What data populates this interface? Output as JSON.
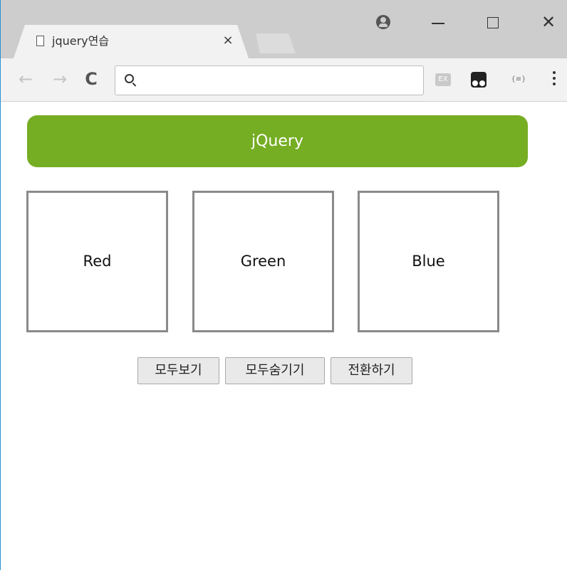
{
  "browser": {
    "tab_title": "jquery연습",
    "tab_close": "×",
    "omnibox_value": "",
    "extensions": {
      "ex_label": "EX",
      "json_label": "{≡}"
    },
    "icons": {
      "back": "←",
      "forward": "→",
      "reload": "C",
      "close": "✕"
    }
  },
  "page": {
    "header": "jQuery",
    "boxes": [
      "Red",
      "Green",
      "Blue"
    ],
    "buttons": {
      "show_all": "모두보기",
      "hide_all": "모두숨기기",
      "toggle": "전환하기"
    }
  },
  "colors": {
    "header_bg": "#75ad23",
    "box_border": "#8a8a8a",
    "window_border": "#2b8fd6"
  }
}
